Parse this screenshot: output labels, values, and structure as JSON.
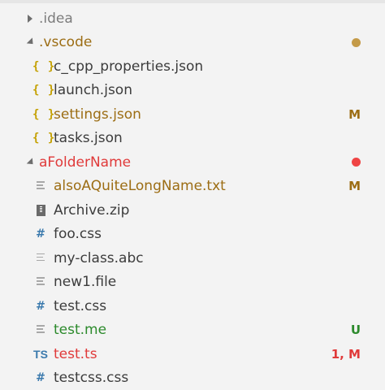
{
  "colors": {
    "modified": "#9c6d14",
    "error": "#e03a3a",
    "untracked": "#2c8a2c",
    "default": "#3c3c3c",
    "folder_modified_dot": "#c49a48",
    "folder_error_dot": "#ef4444"
  },
  "explorer": {
    "items": [
      {
        "label": ".idea",
        "kind": "folder",
        "state": "collapsed",
        "status": "",
        "icon": "chevron-right-icon"
      },
      {
        "label": ".vscode",
        "kind": "folder",
        "state": "expanded",
        "status": "dot-modified",
        "icon": "chevron-down-icon"
      },
      {
        "label": "c_cpp_properties.json",
        "kind": "file",
        "icon_text": "{ }",
        "icon": "json-icon",
        "status": ""
      },
      {
        "label": "launch.json",
        "kind": "file",
        "icon_text": "{ }",
        "icon": "json-icon",
        "status": ""
      },
      {
        "label": "settings.json",
        "kind": "file",
        "icon_text": "{ }",
        "icon": "json-icon",
        "status": "M"
      },
      {
        "label": "tasks.json",
        "kind": "file",
        "icon_text": "{ }",
        "icon": "json-icon",
        "status": ""
      },
      {
        "label": "aFolderName",
        "kind": "folder",
        "state": "expanded",
        "status": "dot-error",
        "icon": "chevron-down-icon"
      },
      {
        "label": "alsoAQuiteLongName.txt",
        "kind": "file",
        "icon": "text-file-icon",
        "status": "M"
      },
      {
        "label": "Archive.zip",
        "kind": "file",
        "icon": "zip-icon",
        "status": ""
      },
      {
        "label": "foo.css",
        "kind": "file",
        "icon_text": "#",
        "icon": "css-icon",
        "status": ""
      },
      {
        "label": "my-class.abc",
        "kind": "file",
        "icon": "text-file-icon",
        "status": ""
      },
      {
        "label": "new1.file",
        "kind": "file",
        "icon": "text-file-icon",
        "status": ""
      },
      {
        "label": "test.css",
        "kind": "file",
        "icon_text": "#",
        "icon": "css-icon",
        "status": ""
      },
      {
        "label": "test.me",
        "kind": "file",
        "icon": "text-file-icon",
        "status": "U"
      },
      {
        "label": "test.ts",
        "kind": "file",
        "icon_text": "TS",
        "icon": "typescript-icon",
        "status": "1, M"
      },
      {
        "label": "testcss.css",
        "kind": "file",
        "icon_text": "#",
        "icon": "css-icon",
        "status": ""
      }
    ]
  }
}
